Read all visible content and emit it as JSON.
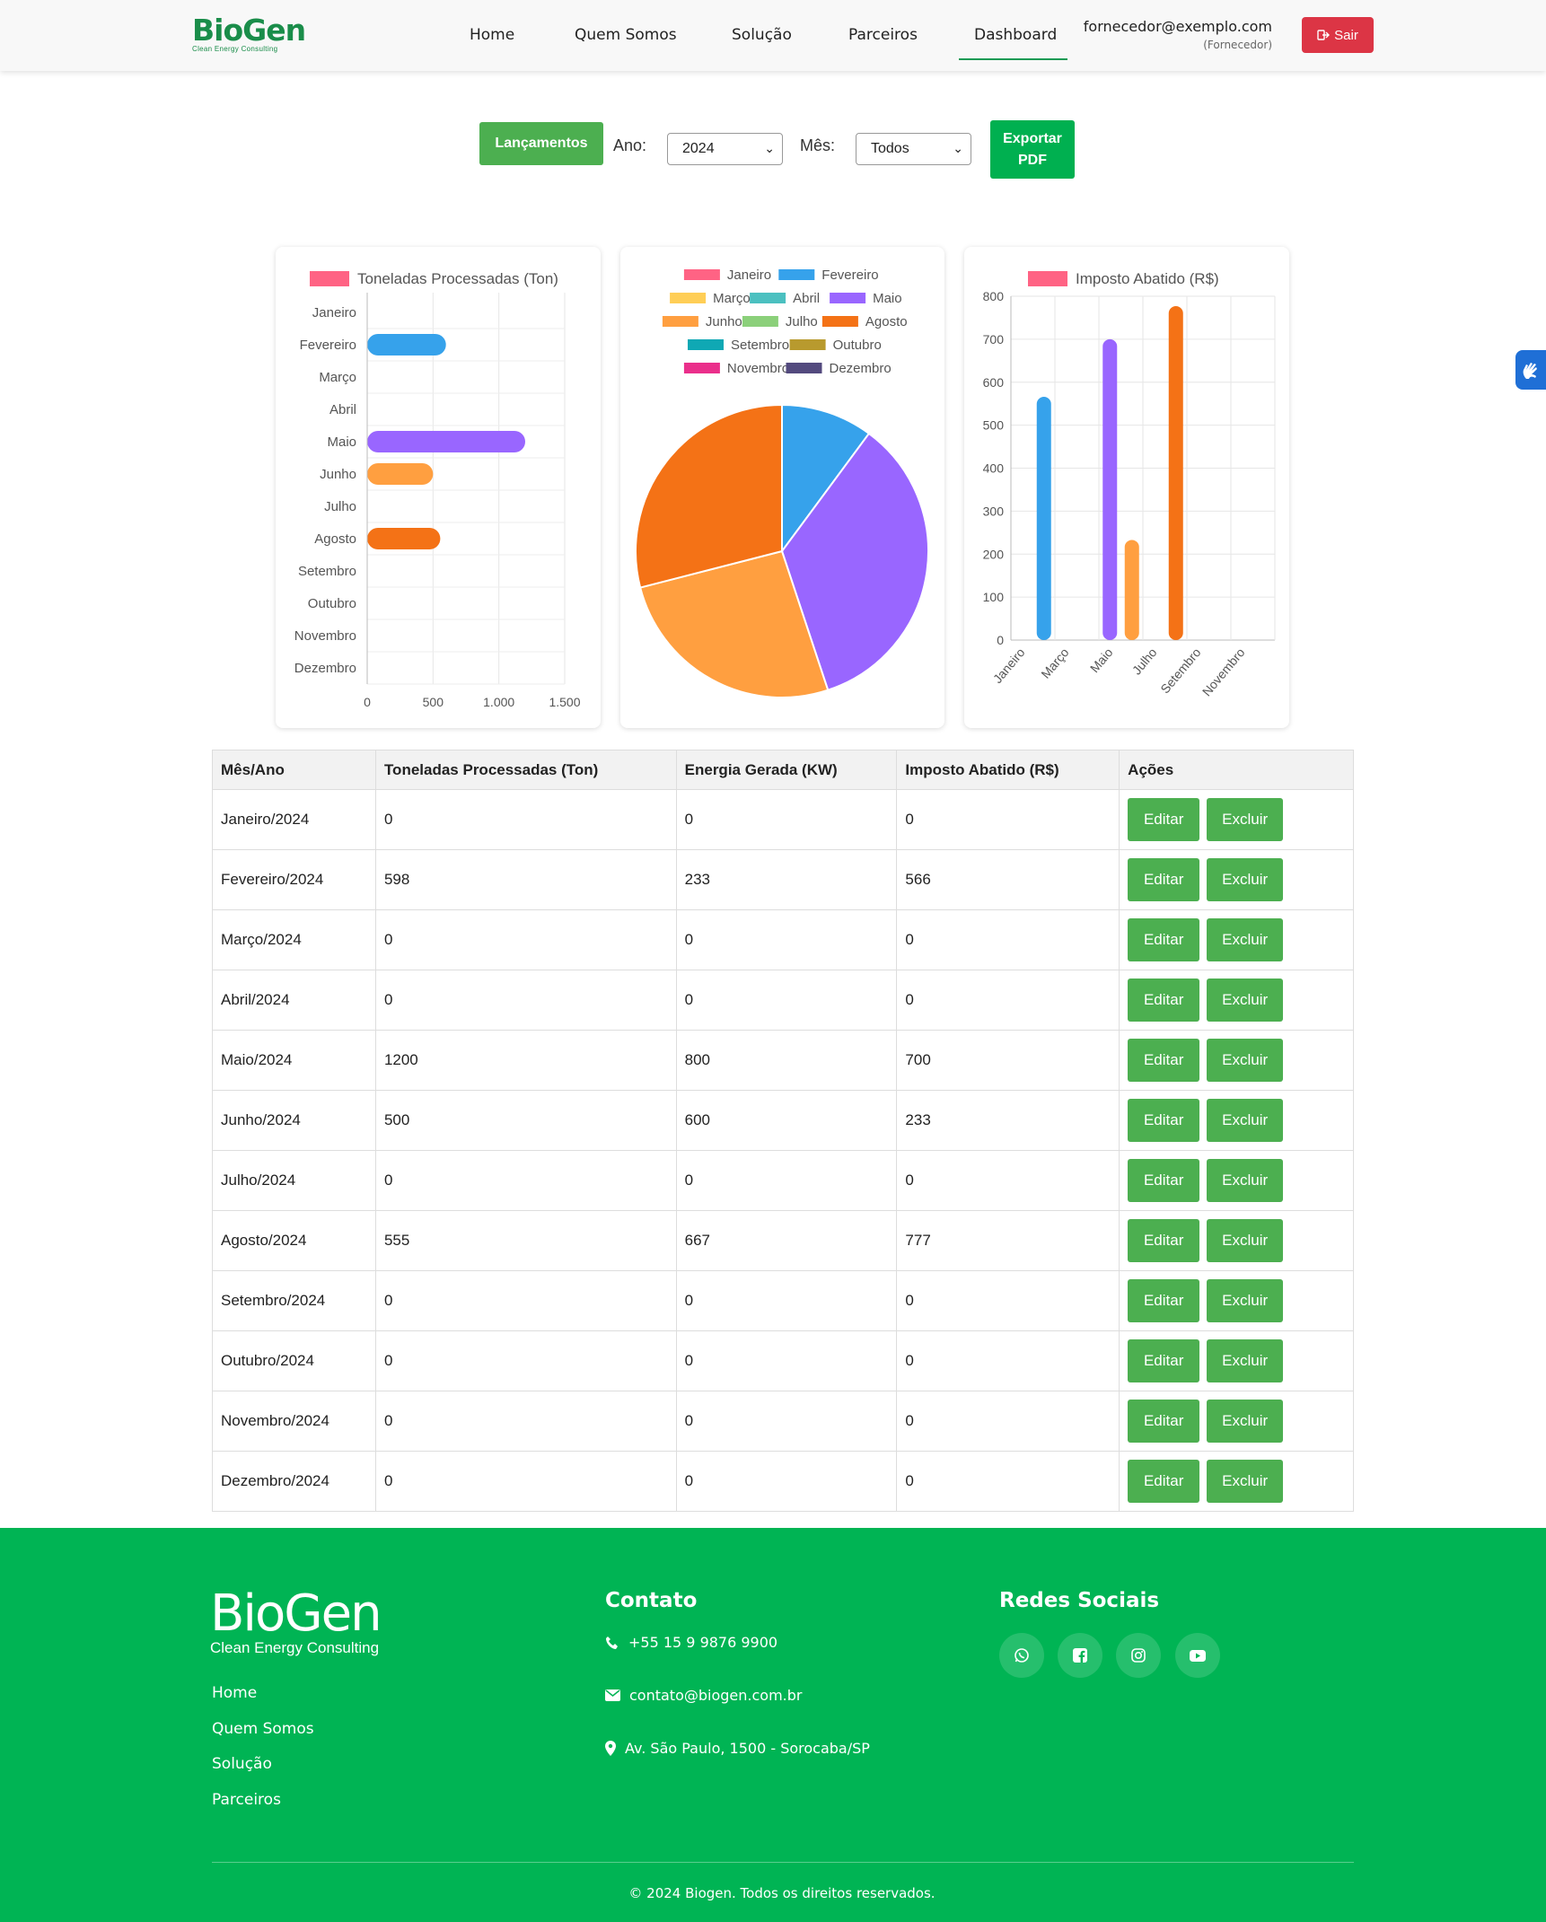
{
  "header": {
    "logo_main": "BioGen",
    "logo_sub": "Clean Energy Consulting",
    "nav": [
      "Home",
      "Quem Somos",
      "Solução",
      "Parceiros",
      "Dashboard"
    ],
    "active_nav": "Dashboard",
    "user_email": "fornecedor@exemplo.com",
    "user_role": "(Fornecedor)",
    "logout_label": "Sair"
  },
  "toolbar": {
    "lancamentos_label": "Lançamentos",
    "ano_label": "Ano:",
    "ano_value": "2024",
    "mes_label": "Mês:",
    "mes_value": "Todos",
    "export_label_1": "Exportar",
    "export_label_2": "PDF"
  },
  "colors": {
    "Janeiro": "#ff6384",
    "Fevereiro": "#36a2eb",
    "Março": "#ffce56",
    "Abril": "#4bc0c0",
    "Maio": "#9966ff",
    "Junho": "#ff9f40",
    "Julho": "#8bd07a",
    "Agosto": "#f47216",
    "Setembro": "#0fa8b4",
    "Outubro": "#b89a2e",
    "Novembro": "#ea2f8b",
    "Dezembro": "#534a7e"
  },
  "chart_data": [
    {
      "type": "bar",
      "orientation": "horizontal",
      "legend": "Toneladas Processadas (Ton)",
      "categories": [
        "Janeiro",
        "Fevereiro",
        "Março",
        "Abril",
        "Maio",
        "Junho",
        "Julho",
        "Agosto",
        "Setembro",
        "Outubro",
        "Novembro",
        "Dezembro"
      ],
      "values": [
        0,
        598,
        0,
        0,
        1200,
        500,
        0,
        555,
        0,
        0,
        0,
        0
      ],
      "xlim": [
        0,
        1500
      ],
      "xticks": [
        "0",
        "500",
        "1.000",
        "1.500"
      ],
      "grid": true
    },
    {
      "type": "pie",
      "legend": [
        "Janeiro",
        "Fevereiro",
        "Março",
        "Abril",
        "Maio",
        "Junho",
        "Julho",
        "Agosto",
        "Setembro",
        "Outubro",
        "Novembro",
        "Dezembro"
      ],
      "values": [
        0,
        233,
        0,
        0,
        800,
        600,
        0,
        667,
        0,
        0,
        0,
        0
      ]
    },
    {
      "type": "bar",
      "legend": "Imposto Abatido (R$)",
      "categories": [
        "Janeiro",
        "Fevereiro",
        "Março",
        "Abril",
        "Maio",
        "Junho",
        "Julho",
        "Agosto",
        "Setembro",
        "Outubro",
        "Novembro",
        "Dezembro"
      ],
      "values": [
        0,
        566,
        0,
        0,
        700,
        233,
        0,
        777,
        0,
        0,
        0,
        0
      ],
      "xtick_labels": [
        "Janeiro",
        "Março",
        "Maio",
        "Julho",
        "Setembro",
        "Novembro"
      ],
      "ylim": [
        0,
        800
      ],
      "yticks": [
        "0",
        "100",
        "200",
        "300",
        "400",
        "500",
        "600",
        "700",
        "800"
      ],
      "grid": true
    }
  ],
  "table": {
    "headers": [
      "Mês/Ano",
      "Toneladas Processadas (Ton)",
      "Energia Gerada (KW)",
      "Imposto Abatido (R$)",
      "Ações"
    ],
    "edit_label": "Editar",
    "delete_label": "Excluir",
    "rows": [
      [
        "Janeiro/2024",
        "0",
        "0",
        "0"
      ],
      [
        "Fevereiro/2024",
        "598",
        "233",
        "566"
      ],
      [
        "Março/2024",
        "0",
        "0",
        "0"
      ],
      [
        "Abril/2024",
        "0",
        "0",
        "0"
      ],
      [
        "Maio/2024",
        "1200",
        "800",
        "700"
      ],
      [
        "Junho/2024",
        "500",
        "600",
        "233"
      ],
      [
        "Julho/2024",
        "0",
        "0",
        "0"
      ],
      [
        "Agosto/2024",
        "555",
        "667",
        "777"
      ],
      [
        "Setembro/2024",
        "0",
        "0",
        "0"
      ],
      [
        "Outubro/2024",
        "0",
        "0",
        "0"
      ],
      [
        "Novembro/2024",
        "0",
        "0",
        "0"
      ],
      [
        "Dezembro/2024",
        "0",
        "0",
        "0"
      ]
    ]
  },
  "footer": {
    "logo_main": "BioGen",
    "logo_sub": "Clean Energy Consulting",
    "links": [
      "Home",
      "Quem Somos",
      "Solução",
      "Parceiros"
    ],
    "contact_title": "Contato",
    "phone": "+55 15 9 9876 9900",
    "email": "contato@biogen.com.br",
    "address": "Av. São Paulo, 1500 - Sorocaba/SP",
    "social_title": "Redes Sociais",
    "social_icons": [
      "whatsapp-icon",
      "facebook-icon",
      "instagram-icon",
      "youtube-icon"
    ],
    "copyright": "© 2024 Biogen. Todos os direitos reservados."
  }
}
